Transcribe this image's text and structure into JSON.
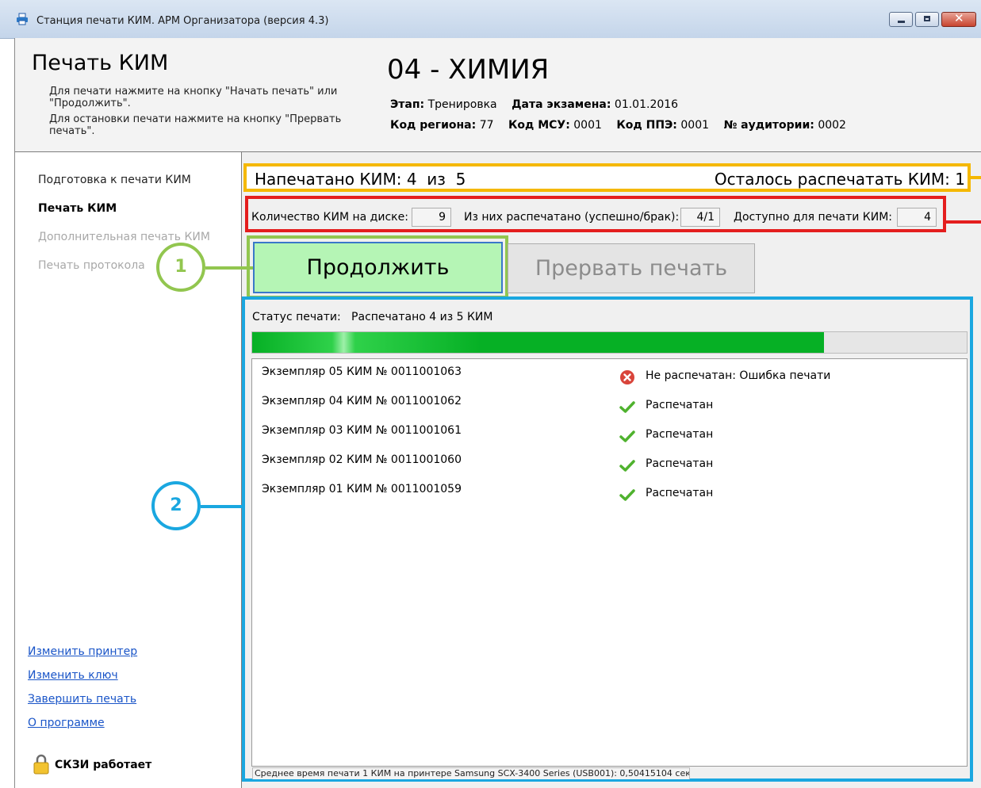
{
  "window": {
    "title": "Станция печати КИМ. АРМ Организатора (версия 4.3)"
  },
  "header": {
    "page_title": "Печать КИМ",
    "hint_line1": "Для печати нажмите на кнопку \"Начать печать\" или",
    "hint_line2": "\"Продолжить\".",
    "hint_line3": "Для остановки печати нажмите на кнопку \"Прервать",
    "hint_line4": "печать\".",
    "exam_title": "04 - ХИМИЯ",
    "stage_label": "Этап:",
    "stage_value": "Тренировка",
    "date_label": "Дата экзамена:",
    "date_value": "01.01.2016",
    "region_label": "Код региона:",
    "region_value": "77",
    "msu_label": "Код МСУ:",
    "msu_value": "0001",
    "ppe_label": "Код ППЭ:",
    "ppe_value": "0001",
    "room_label": "№ аудитории:",
    "room_value": "0002"
  },
  "sidebar": {
    "items": [
      {
        "label": "Подготовка к печати КИМ",
        "state": "normal"
      },
      {
        "label": "Печать КИМ",
        "state": "active"
      },
      {
        "label": "Дополнительная печать КИМ",
        "state": "disabled"
      },
      {
        "label": "Печать протокола",
        "state": "disabled"
      }
    ],
    "links": [
      {
        "label": "Изменить принтер"
      },
      {
        "label": "Изменить ключ"
      },
      {
        "label": "Завершить печать"
      },
      {
        "label": "О программе"
      }
    ],
    "crypto_status": "СКЗИ работает"
  },
  "summary": {
    "printed": "Напечатано КИМ: 4  из  5",
    "remaining": "Осталось распечатать КИМ: 1"
  },
  "counts": {
    "disk_label": "Количество КИМ на диске:",
    "disk_value": "9",
    "printed_label": "Из них распечатано (успешно/брак):",
    "printed_value": "4/1",
    "available_label": "Доступно для печати КИМ:",
    "available_value": "4"
  },
  "buttons": {
    "continue_label": "Продолжить",
    "stop_label": "Прервать печать"
  },
  "callouts": {
    "one": "1",
    "two": "2"
  },
  "status": {
    "label": "Статус печати:",
    "value": "Распечатано 4 из 5 КИМ",
    "progress_fraction": 0.8
  },
  "copies": [
    {
      "label": "Экземпляр 05  КИМ № 0011001063",
      "status": "Не распечатан: Ошибка печати",
      "ok": false
    },
    {
      "label": "Экземпляр 04  КИМ № 0011001062",
      "status": "Распечатан",
      "ok": true
    },
    {
      "label": "Экземпляр 03  КИМ № 0011001061",
      "status": "Распечатан",
      "ok": true
    },
    {
      "label": "Экземпляр 02  КИМ № 0011001060",
      "status": "Распечатан",
      "ok": true
    },
    {
      "label": "Экземпляр 01  КИМ № 0011001059",
      "status": "Распечатан",
      "ok": true
    }
  ],
  "footer": {
    "avg_time": "Среднее время печати 1 КИМ на принтере Samsung SCX-3400 Series (USB001): 0,50415104 сек"
  },
  "colors": {
    "summary_border": "#f5b800",
    "counts_border": "#e41e1e",
    "continue_highlight": "#92c64f",
    "status_border": "#1aa7e0",
    "progress": "#06b025"
  }
}
